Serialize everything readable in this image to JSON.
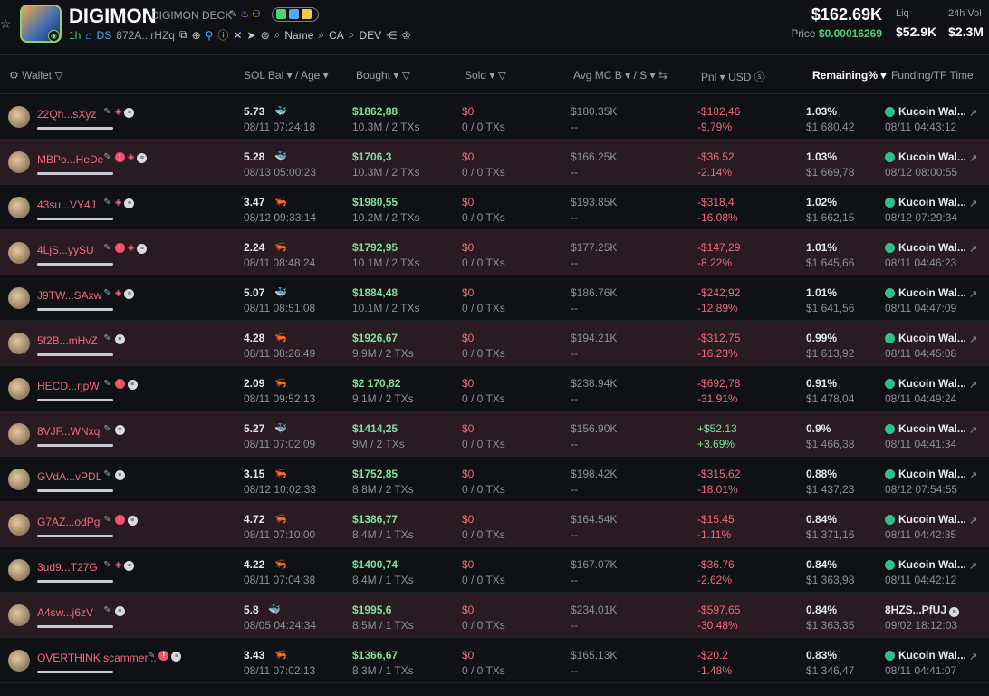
{
  "header": {
    "ticker": "DIGIMON",
    "name": "DIGIMON DECK",
    "age": "1h",
    "ds": "DS",
    "address": "872A...rHZq",
    "links": [
      "Name",
      "CA",
      "DEV"
    ],
    "market_cap": "$162.69K",
    "price_label": "Price",
    "price": "$0.00016269",
    "liq_label": "Liq",
    "liq": "$52.9K",
    "vol_label": "24h Vol",
    "vol": "$2.3M"
  },
  "columns": {
    "wallet": "Wallet",
    "sol": "SOL Bal",
    "age": "/ Age",
    "bought": "Bought",
    "sold": "Sold",
    "avg": "Avg MC B",
    "avg_s": "/ S",
    "pnl": "Pnl",
    "usd": "USD",
    "remaining": "Remaining%",
    "funding": "Funding/TF Time"
  },
  "rows": [
    {
      "wallet": "22Qh...sXyz",
      "warn": false,
      "layers": true,
      "sol": "5.73",
      "fish": "whale",
      "age": "08/11 07:24:18",
      "bought": "$1862,88",
      "bought_sub": "10.3M / 2 TXs",
      "sold": "$0",
      "sold_sub": "0 / 0 TXs",
      "avg": "$180.35K",
      "avg_sub": "--",
      "pnl": "-$182,46",
      "pnl_pct": "-9.79%",
      "pos": false,
      "rem": "1.03%",
      "rem_sub": "$1 680,42",
      "fund": "Kucoin Wal...",
      "fund_time": "08/11 04:43:12"
    },
    {
      "wallet": "MBPo...HeDe",
      "warn": true,
      "layers": true,
      "sol": "5.28",
      "fish": "whale",
      "age": "08/13 05:00:23",
      "bought": "$1706,3",
      "bought_sub": "10.3M / 2 TXs",
      "sold": "$0",
      "sold_sub": "0 / 0 TXs",
      "avg": "$166.25K",
      "avg_sub": "--",
      "pnl": "-$36.52",
      "pnl_pct": "-2.14%",
      "pos": false,
      "rem": "1.03%",
      "rem_sub": "$1 669,78",
      "fund": "Kucoin Wal...",
      "fund_time": "08/12 08:00:55"
    },
    {
      "wallet": "43su...VY4J",
      "warn": false,
      "layers": true,
      "sol": "3.47",
      "fish": "shrimp",
      "age": "08/12 09:33:14",
      "bought": "$1980,55",
      "bought_sub": "10.2M / 2 TXs",
      "sold": "$0",
      "sold_sub": "0 / 0 TXs",
      "avg": "$193.85K",
      "avg_sub": "--",
      "pnl": "-$318,4",
      "pnl_pct": "-16.08%",
      "pos": false,
      "rem": "1.02%",
      "rem_sub": "$1 662,15",
      "fund": "Kucoin Wal...",
      "fund_time": "08/12 07:29:34"
    },
    {
      "wallet": "4LjS...yySU",
      "warn": true,
      "layers": true,
      "sol": "2.24",
      "fish": "shrimp",
      "age": "08/11 08:48:24",
      "bought": "$1792,95",
      "bought_sub": "10.1M / 2 TXs",
      "sold": "$0",
      "sold_sub": "0 / 0 TXs",
      "avg": "$177.25K",
      "avg_sub": "--",
      "pnl": "-$147,29",
      "pnl_pct": "-8.22%",
      "pos": false,
      "rem": "1.01%",
      "rem_sub": "$1 645,66",
      "fund": "Kucoin Wal...",
      "fund_time": "08/11 04:46:23"
    },
    {
      "wallet": "J9TW...SAxw",
      "warn": false,
      "layers": true,
      "sol": "5.07",
      "fish": "whale",
      "age": "08/11 08:51:08",
      "bought": "$1884,48",
      "bought_sub": "10.1M / 2 TXs",
      "sold": "$0",
      "sold_sub": "0 / 0 TXs",
      "avg": "$186.76K",
      "avg_sub": "--",
      "pnl": "-$242,92",
      "pnl_pct": "-12.89%",
      "pos": false,
      "rem": "1.01%",
      "rem_sub": "$1 641,56",
      "fund": "Kucoin Wal...",
      "fund_time": "08/11 04:47:09"
    },
    {
      "wallet": "5f2B...mHvZ",
      "warn": false,
      "layers": false,
      "sol": "4.28",
      "fish": "shrimp",
      "age": "08/11 08:26:49",
      "bought": "$1926,67",
      "bought_sub": "9.9M / 2 TXs",
      "sold": "$0",
      "sold_sub": "0 / 0 TXs",
      "avg": "$194.21K",
      "avg_sub": "--",
      "pnl": "-$312,75",
      "pnl_pct": "-16.23%",
      "pos": false,
      "rem": "0.99%",
      "rem_sub": "$1 613,92",
      "fund": "Kucoin Wal...",
      "fund_time": "08/11 04:45:08"
    },
    {
      "wallet": "HECD...rjpW",
      "warn": true,
      "layers": false,
      "sol": "2.09",
      "fish": "shrimp",
      "age": "08/11 09:52:13",
      "bought": "$2 170,82",
      "bought_sub": "9.1M / 2 TXs",
      "sold": "$0",
      "sold_sub": "0 / 0 TXs",
      "avg": "$238.94K",
      "avg_sub": "--",
      "pnl": "-$692,78",
      "pnl_pct": "-31.91%",
      "pos": false,
      "rem": "0.91%",
      "rem_sub": "$1 478,04",
      "fund": "Kucoin Wal...",
      "fund_time": "08/11 04:49:24"
    },
    {
      "wallet": "8VJF...WNxq",
      "warn": false,
      "layers": false,
      "sol": "5.27",
      "fish": "whale",
      "age": "08/11 07:02:09",
      "bought": "$1414,25",
      "bought_sub": "9M / 2 TXs",
      "sold": "$0",
      "sold_sub": "0 / 0 TXs",
      "avg": "$156.90K",
      "avg_sub": "--",
      "pnl": "+$52.13",
      "pnl_pct": "+3.69%",
      "pos": true,
      "rem": "0.9%",
      "rem_sub": "$1 466,38",
      "fund": "Kucoin Wal...",
      "fund_time": "08/11 04:41:34"
    },
    {
      "wallet": "GVdA...vPDL",
      "warn": false,
      "layers": false,
      "sol": "3.15",
      "fish": "shrimp",
      "age": "08/12 10:02:33",
      "bought": "$1752,85",
      "bought_sub": "8.8M / 2 TXs",
      "sold": "$0",
      "sold_sub": "0 / 0 TXs",
      "avg": "$198.42K",
      "avg_sub": "--",
      "pnl": "-$315,62",
      "pnl_pct": "-18.01%",
      "pos": false,
      "rem": "0.88%",
      "rem_sub": "$1 437,23",
      "fund": "Kucoin Wal...",
      "fund_time": "08/12 07:54:55"
    },
    {
      "wallet": "G7AZ...odPg",
      "warn": true,
      "layers": false,
      "sol": "4.72",
      "fish": "shrimp",
      "age": "08/11 07:10:00",
      "bought": "$1386,77",
      "bought_sub": "8.4M / 1 TXs",
      "sold": "$0",
      "sold_sub": "0 / 0 TXs",
      "avg": "$164.54K",
      "avg_sub": "--",
      "pnl": "-$15.45",
      "pnl_pct": "-1.11%",
      "pos": false,
      "rem": "0.84%",
      "rem_sub": "$1 371,16",
      "fund": "Kucoin Wal...",
      "fund_time": "08/11 04:42:35"
    },
    {
      "wallet": "3ud9...T27G",
      "warn": false,
      "layers": true,
      "sol": "4.22",
      "fish": "shrimp",
      "age": "08/11 07:04:38",
      "bought": "$1400,74",
      "bought_sub": "8.4M / 1 TXs",
      "sold": "$0",
      "sold_sub": "0 / 0 TXs",
      "avg": "$167.07K",
      "avg_sub": "--",
      "pnl": "-$36.76",
      "pnl_pct": "-2.62%",
      "pos": false,
      "rem": "0.84%",
      "rem_sub": "$1 363,98",
      "fund": "Kucoin Wal...",
      "fund_time": "08/11 04:42:12"
    },
    {
      "wallet": "A4sw...j6zV",
      "warn": false,
      "layers": false,
      "sol": "5.8",
      "fish": "whale",
      "age": "08/05 04:24:34",
      "bought": "$1995,6",
      "bought_sub": "8.5M / 1 TXs",
      "sold": "$0",
      "sold_sub": "0 / 0 TXs",
      "avg": "$234.01K",
      "avg_sub": "--",
      "pnl": "-$597,65",
      "pnl_pct": "-30.48%",
      "pos": false,
      "rem": "0.84%",
      "rem_sub": "$1 363,35",
      "fund": "8HZS...PfUJ",
      "fund_time": "09/02 18:12:03",
      "plain": true
    },
    {
      "wallet": "OVERTHINK scammer...",
      "warn": true,
      "layers": false,
      "sol": "3.43",
      "fish": "shrimp",
      "age": "08/11 07:02:13",
      "bought": "$1366,67",
      "bought_sub": "8.3M / 1 TXs",
      "sold": "$0",
      "sold_sub": "0 / 0 TXs",
      "avg": "$165.13K",
      "avg_sub": "--",
      "pnl": "-$20.2",
      "pnl_pct": "-1.48%",
      "pos": false,
      "rem": "0.83%",
      "rem_sub": "$1 346,47",
      "fund": "Kucoin Wal...",
      "fund_time": "08/11 04:41:07"
    }
  ],
  "colors": {
    "green": "#7ee09a",
    "red": "#f06a7d",
    "bg": "#0f1115",
    "alt_row": "#2a1b22"
  }
}
